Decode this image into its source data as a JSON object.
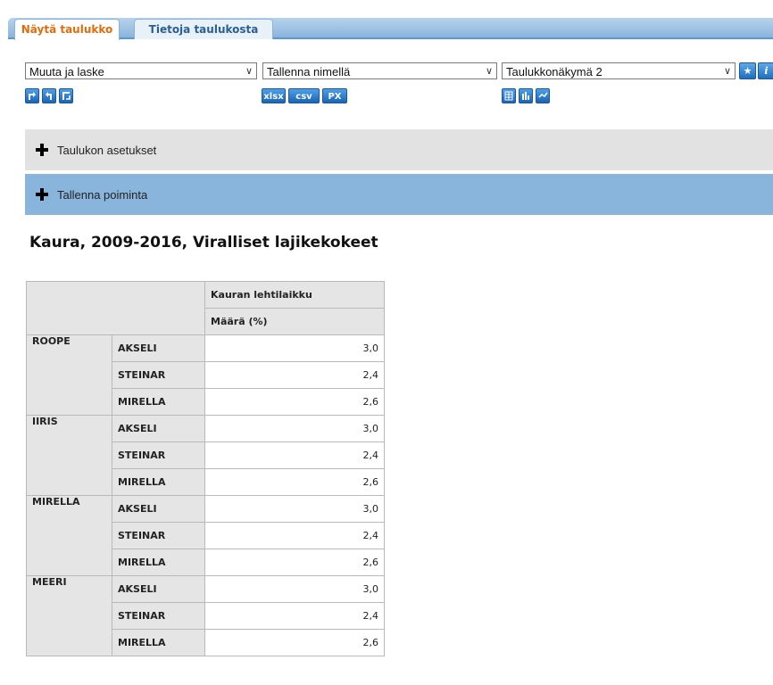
{
  "tabs": [
    {
      "label": "Näytä taulukko",
      "active": true
    },
    {
      "label": "Tietoja taulukosta",
      "active": false
    }
  ],
  "selects": {
    "calculate": "Muuta ja laske",
    "save_as": "Tallenna nimellä",
    "table_view": "Taulukkonäkymä 2"
  },
  "export_buttons": [
    "xlsx",
    "csv",
    "PX"
  ],
  "icons": {
    "pivot_left": "pivot-clockwise-icon",
    "pivot_right": "pivot-counterclockwise-icon",
    "transpose": "transpose-icon",
    "table_view": "table-view-icon",
    "bar_chart": "bar-chart-icon",
    "line_chart": "line-chart-icon",
    "star": "star-icon",
    "info": "info-icon"
  },
  "bars": {
    "settings": "Taulukon asetukset",
    "save_extract": "Tallenna poiminta"
  },
  "table": {
    "title": "Kaura, 2009-2016, Viralliset lajikekokeet",
    "column_header": "Kauran lehtilaikku",
    "measure_header": "Määrä (%)",
    "groups": [
      {
        "name": "ROOPE",
        "rows": [
          {
            "sub": "AKSELI",
            "value": "3,0"
          },
          {
            "sub": "STEINAR",
            "value": "2,4"
          },
          {
            "sub": "MIRELLA",
            "value": "2,6"
          }
        ]
      },
      {
        "name": "IIRIS",
        "rows": [
          {
            "sub": "AKSELI",
            "value": "3,0"
          },
          {
            "sub": "STEINAR",
            "value": "2,4"
          },
          {
            "sub": "MIRELLA",
            "value": "2,6"
          }
        ]
      },
      {
        "name": "MIRELLA",
        "rows": [
          {
            "sub": "AKSELI",
            "value": "3,0"
          },
          {
            "sub": "STEINAR",
            "value": "2,4"
          },
          {
            "sub": "MIRELLA",
            "value": "2,6"
          }
        ]
      },
      {
        "name": "MEERI",
        "rows": [
          {
            "sub": "AKSELI",
            "value": "3,0"
          },
          {
            "sub": "STEINAR",
            "value": "2,4"
          },
          {
            "sub": "MIRELLA",
            "value": "2,6"
          }
        ]
      }
    ]
  },
  "colors": {
    "active_tab_text": "#e46c0a",
    "inactive_tab_text": "#2a5f96",
    "save_bar": "#89b4db",
    "settings_bar": "#e2e2e2",
    "header_cell": "#e5e5e5"
  }
}
